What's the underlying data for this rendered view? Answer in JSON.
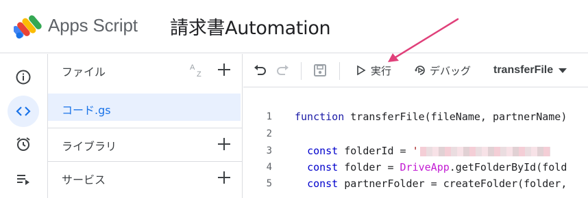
{
  "header": {
    "app_name": "Apps Script",
    "project_name": "請求書Automation"
  },
  "rail": {
    "items": [
      {
        "icon": "info-icon"
      },
      {
        "icon": "code-icon",
        "active": true
      },
      {
        "icon": "alarm-clock-icon"
      },
      {
        "icon": "executions-icon"
      }
    ]
  },
  "files": {
    "section_label": "ファイル",
    "sort_icon": "sort-az-icon",
    "items": [
      {
        "name": "コード.gs",
        "selected": true
      }
    ],
    "libraries_label": "ライブラリ",
    "services_label": "サービス"
  },
  "toolbar": {
    "run_label": "実行",
    "debug_label": "デバッグ",
    "function_select": "transferFile"
  },
  "editor": {
    "lines": [
      {
        "num": "1",
        "parts": [
          {
            "t": "function",
            "c": "kw"
          },
          {
            "t": " transferFile(fileName, partnerName)"
          }
        ]
      },
      {
        "num": "2",
        "parts": []
      },
      {
        "num": "3",
        "parts": [
          {
            "t": "  "
          },
          {
            "t": "const",
            "c": "kw2"
          },
          {
            "t": " folderId = "
          },
          {
            "t": "'",
            "c": "str"
          }
        ],
        "redacted": true
      },
      {
        "num": "4",
        "parts": [
          {
            "t": "  "
          },
          {
            "t": "const",
            "c": "kw2"
          },
          {
            "t": " folder = "
          },
          {
            "t": "DriveApp",
            "c": "svc"
          },
          {
            "t": ".getFolderById(fold"
          }
        ]
      },
      {
        "num": "5",
        "parts": [
          {
            "t": "  "
          },
          {
            "t": "const",
            "c": "kw2"
          },
          {
            "t": " partnerFolder = createFolder(folder,"
          }
        ]
      }
    ]
  },
  "colors": {
    "accent": "#1a73e8",
    "active_bg": "#e8f0fe",
    "annotation_arrow": "#e0407a"
  }
}
